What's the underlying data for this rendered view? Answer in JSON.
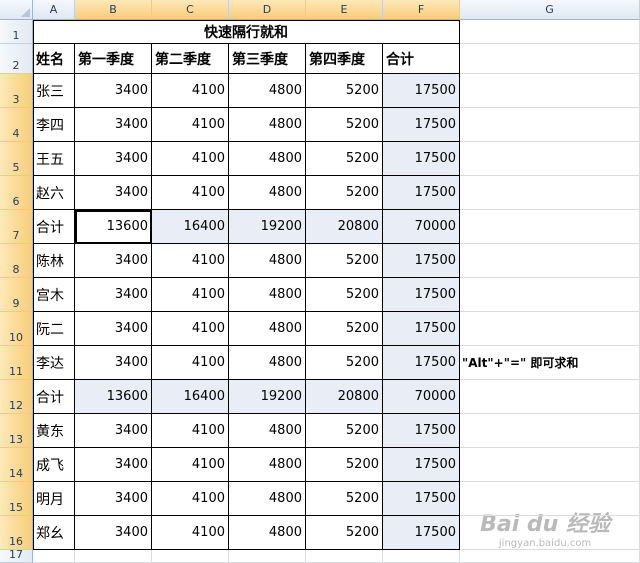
{
  "columns": [
    "A",
    "B",
    "C",
    "D",
    "E",
    "F",
    "G"
  ],
  "selected_columns": [
    "B",
    "C",
    "D",
    "E",
    "F"
  ],
  "rows": [
    "1",
    "2",
    "3",
    "4",
    "5",
    "6",
    "7",
    "8",
    "9",
    "10",
    "11",
    "12",
    "13",
    "14",
    "15",
    "16",
    "17"
  ],
  "selected_rows": [
    "3",
    "4",
    "5",
    "6",
    "7",
    "8",
    "9",
    "10",
    "11",
    "12",
    "13",
    "14",
    "15",
    "16"
  ],
  "title": "快速隔行就和",
  "headers": [
    "姓名",
    "第一季度",
    "第二季度",
    "第三季度",
    "第四季度",
    "合计"
  ],
  "data_rows": [
    {
      "name": "张三",
      "values": [
        "3400",
        "4100",
        "4800",
        "5200",
        "17500"
      ]
    },
    {
      "name": "李四",
      "values": [
        "3400",
        "4100",
        "4800",
        "5200",
        "17500"
      ]
    },
    {
      "name": "王五",
      "values": [
        "3400",
        "4100",
        "4800",
        "5200",
        "17500"
      ]
    },
    {
      "name": "赵六",
      "values": [
        "3400",
        "4100",
        "4800",
        "5200",
        "17500"
      ]
    },
    {
      "name": "合计",
      "values": [
        "13600",
        "16400",
        "19200",
        "20800",
        "70000"
      ],
      "subtotal": true
    },
    {
      "name": "陈林",
      "values": [
        "3400",
        "4100",
        "4800",
        "5200",
        "17500"
      ]
    },
    {
      "name": "宫木",
      "values": [
        "3400",
        "4100",
        "4800",
        "5200",
        "17500"
      ]
    },
    {
      "name": "阮二",
      "values": [
        "3400",
        "4100",
        "4800",
        "5200",
        "17500"
      ]
    },
    {
      "name": "李达",
      "values": [
        "3400",
        "4100",
        "4800",
        "5200",
        "17500"
      ]
    },
    {
      "name": "合计",
      "values": [
        "13600",
        "16400",
        "19200",
        "20800",
        "70000"
      ],
      "subtotal": true
    },
    {
      "name": "黄东",
      "values": [
        "3400",
        "4100",
        "4800",
        "5200",
        "17500"
      ]
    },
    {
      "name": "成飞",
      "values": [
        "3400",
        "4100",
        "4800",
        "5200",
        "17500"
      ]
    },
    {
      "name": "明月",
      "values": [
        "3400",
        "4100",
        "4800",
        "5200",
        "17500"
      ]
    },
    {
      "name": "郑幺",
      "values": [
        "3400",
        "4100",
        "4800",
        "5200",
        "17500"
      ]
    }
  ],
  "note": "\"Alt\"+\"=\" 即可求和",
  "watermark": {
    "main": "Bai du 经验",
    "sub": "jingyan.baidu.com"
  }
}
